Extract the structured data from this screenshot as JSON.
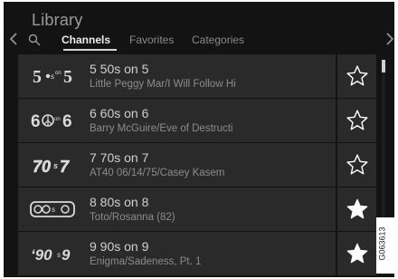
{
  "header": {
    "title": "Library"
  },
  "tabs": [
    {
      "label": "Channels",
      "active": true
    },
    {
      "label": "Favorites",
      "active": false
    },
    {
      "label": "Categories",
      "active": false
    }
  ],
  "channels": [
    {
      "logo": "5 50s 5",
      "title": "5 50s on 5",
      "subtitle": "Little Peggy Mar/I Will Follow Hi",
      "favorite": false
    },
    {
      "logo": "6 60s 6",
      "title": "6 60s on 6",
      "subtitle": "Barry McGuire/Eve of Destructi",
      "favorite": false
    },
    {
      "logo": "70s 7",
      "title": "7 70s on 7",
      "subtitle": "AT40 06/14/75/Casey Kasem",
      "favorite": false
    },
    {
      "logo": "80s 8",
      "title": "8 80s on 8",
      "subtitle": "Toto/Rosanna (82)",
      "favorite": true
    },
    {
      "logo": "90s 9",
      "title": "9 90s on 9",
      "subtitle": "Enigma/Sadeness, Pt. 1",
      "favorite": true
    }
  ],
  "figure_code": "G063613",
  "icons": {
    "left_arrow": "chevron-left-icon",
    "right_arrow": "chevron-right-icon",
    "search": "search-icon",
    "favorite_off": "star-outline-icon",
    "favorite_on": "star-filled-icon"
  },
  "colors": {
    "background": "#131313",
    "row": "#2a2a2a",
    "star": "#ffffff"
  }
}
